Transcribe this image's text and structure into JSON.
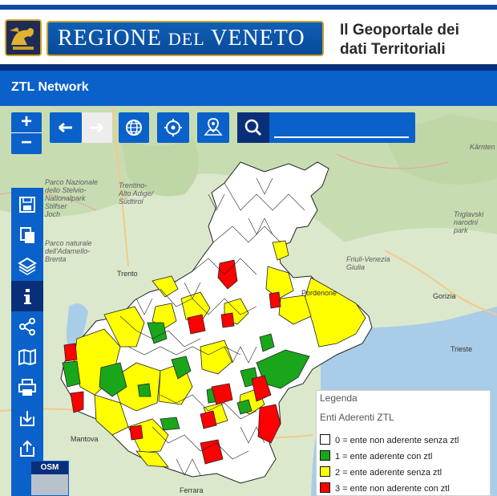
{
  "header": {
    "banner_main": "REGIONE ",
    "banner_small": "DEL",
    "banner_end": " VENETO",
    "geoportal_line1": "Il Geoportale dei",
    "geoportal_line2": "dati Territoriali"
  },
  "app": {
    "title": "ZTL Network"
  },
  "toolbar": {
    "zoom_in": "+",
    "zoom_out": "−",
    "search_placeholder": "",
    "search_value": ""
  },
  "map_labels": {
    "stelvio": "Parco Nazionale\ndello Stelvio-\nNationalpark\nStilfser\nJoch",
    "trentino": "Trentino-\nAlto Adige/\nSüdtirol",
    "adamello": "Parco naturale\ndell'Adamello-\nBrenta",
    "trento": "Trento",
    "friuli": "Friuli-Venezia\nGiulia",
    "pordenone": "Pordenone",
    "gorizia": "Gorizia",
    "trieste": "Trieste",
    "triglav": "Triglavski\nnarodni\npark",
    "karnten": "Kärnten",
    "mantova": "Mantova",
    "ferrara": "Ferrara"
  },
  "basemap": {
    "label": "OSM"
  },
  "legend": {
    "title": "Legenda",
    "subtitle": "Enti Aderenti ZTL",
    "items": [
      {
        "label": "0 = ente non aderente senza ztl",
        "color": "#ffffff"
      },
      {
        "label": "1 = ente aderente con ztl",
        "color": "#1aa61a"
      },
      {
        "label": "2 = ente aderente senza ztl",
        "color": "#ffff00"
      },
      {
        "label": "3 = ente non aderente con ztl",
        "color": "#ff0000"
      }
    ]
  },
  "colors": {
    "header_blue": "#0a61c9",
    "dark_blue": "#0a2f7a",
    "gold": "#c9a227"
  },
  "sidebar_icons": [
    "save-icon",
    "copy-icon",
    "layers-icon",
    "info-icon",
    "share-icon",
    "map-catalog-icon",
    "print-icon",
    "download-icon",
    "export-icon"
  ],
  "toolbar_icons": [
    "back-arrow-icon",
    "forward-arrow-icon",
    "globe-icon",
    "locate-icon",
    "map-pin-icon",
    "search-icon"
  ]
}
